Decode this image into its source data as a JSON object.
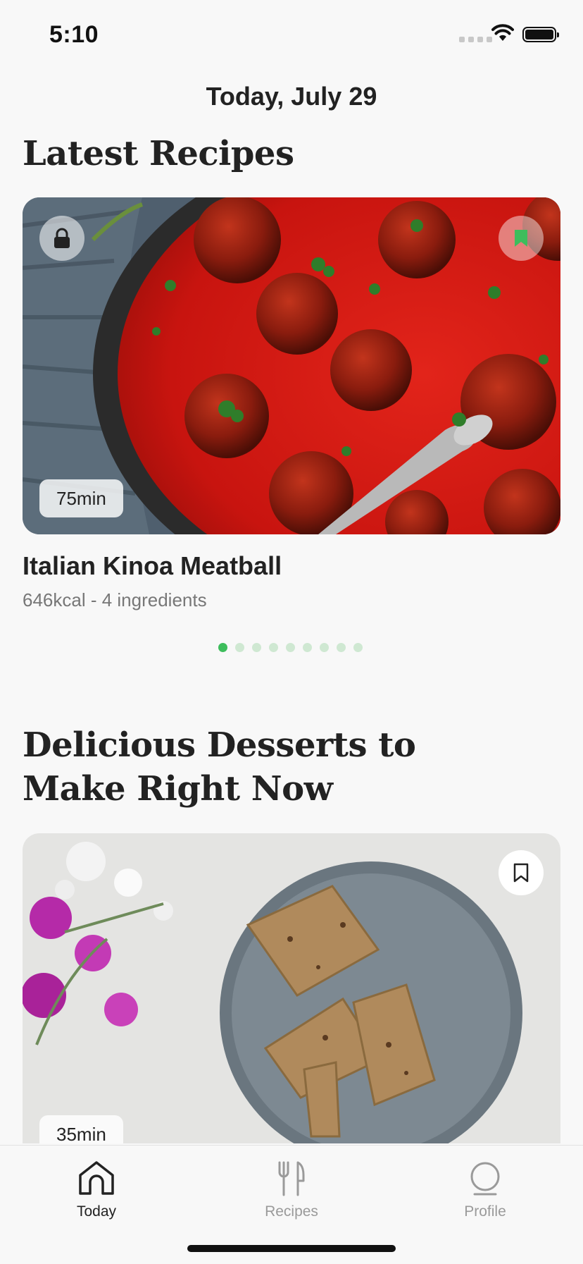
{
  "status_bar": {
    "time": "5:10",
    "icons": [
      "signal-icon",
      "wifi-icon",
      "battery-icon"
    ]
  },
  "header": {
    "date": "Today, July 29"
  },
  "latest": {
    "section_title": "Latest Recipes",
    "card": {
      "image": "meatballs-in-tomato-sauce",
      "duration": "75min",
      "locked": true,
      "bookmarked": true,
      "title": "Italian Kinoa Meatball",
      "meta": "646kcal - 4 ingredients"
    },
    "pager": {
      "count": 9,
      "active_index": 0
    }
  },
  "desserts": {
    "section_title": "Delicious Desserts to Make Right Now",
    "card": {
      "image": "granola-bars-on-plate",
      "duration": "35min",
      "bookmarked": false
    }
  },
  "tab_bar": {
    "tabs": [
      {
        "label": "Today",
        "icon": "home-icon",
        "active": true
      },
      {
        "label": "Recipes",
        "icon": "utensils-icon",
        "active": false
      },
      {
        "label": "Profile",
        "icon": "profile-icon",
        "active": false
      }
    ]
  },
  "colors": {
    "accent_green": "#3dbd5c",
    "dot_inactive": "#cfe8d2",
    "background": "#f8f8f8",
    "text_primary": "#222222",
    "text_secondary": "#777777"
  }
}
